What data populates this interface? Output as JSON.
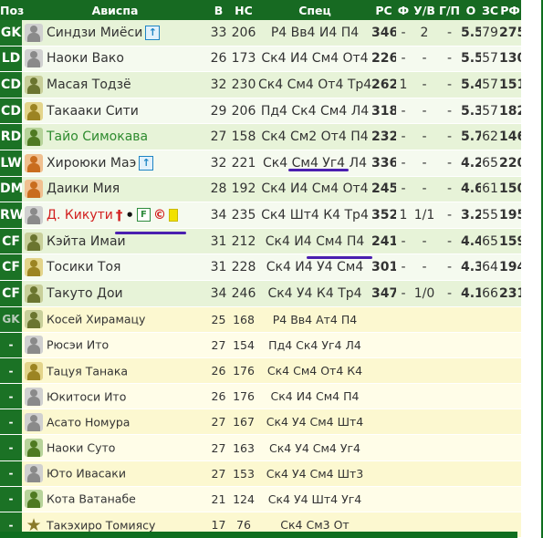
{
  "headers": {
    "pos": "Поз",
    "name": "Ависпа",
    "age": "В",
    "hs": "НС",
    "spec": "Спец",
    "rs": "РС",
    "f": "Ф",
    "uv": "У/В",
    "gp": "Г/П",
    "o": "О",
    "zs": "ЗС",
    "rf": "РФ"
  },
  "colors": {
    "header_green": "#176a22",
    "underline": "#4a1fb0",
    "bold_value_color": "#333333"
  },
  "starters": [
    {
      "pos": "GK",
      "name": "Синдзи Миёси",
      "age": "33",
      "hs": "206",
      "spec": "Р4 Вв4 И4 П4",
      "rs": "346",
      "f": "-",
      "uv": "2",
      "gp": "-",
      "o": "5.5",
      "zs": "79",
      "rf": "275",
      "avatar": "gray",
      "icons": [
        "captain-icon"
      ],
      "name_color": "default"
    },
    {
      "pos": "LD",
      "name": "Наоки Вако",
      "age": "26",
      "hs": "173",
      "spec": "Ск4 И4 См4 От4",
      "rs": "226",
      "f": "-",
      "uv": "-",
      "gp": "-",
      "o": "5.5",
      "zs": "57",
      "rf": "130",
      "avatar": "gray",
      "icons": [],
      "name_color": "default"
    },
    {
      "pos": "CD",
      "name": "Масая Тодзё",
      "age": "32",
      "hs": "230",
      "spec": "Ск4 См4 От4 Тр4",
      "rs": "262",
      "f": "1",
      "uv": "-",
      "gp": "-",
      "o": "5.4",
      "zs": "57",
      "rf": "151",
      "avatar": "olive",
      "icons": [],
      "name_color": "default"
    },
    {
      "pos": "CD",
      "name": "Такааки Сити",
      "age": "29",
      "hs": "206",
      "spec": "Пд4 Ск4 См4 Л4",
      "rs": "318",
      "f": "-",
      "uv": "-",
      "gp": "-",
      "o": "5.3",
      "zs": "57",
      "rf": "182",
      "avatar": "gold",
      "icons": [],
      "name_color": "default"
    },
    {
      "pos": "RD",
      "name": "Тайо Симокава",
      "age": "27",
      "hs": "158",
      "spec": "Ск4 См2 От4 П4",
      "rs": "232",
      "f": "-",
      "uv": "-",
      "gp": "-",
      "o": "5.7",
      "zs": "62",
      "rf": "146",
      "avatar": "green",
      "icons": [],
      "name_color": "green"
    },
    {
      "pos": "LW",
      "name": "Хироюки Маэ",
      "age": "32",
      "hs": "221",
      "spec": "Ск4 См4 Уг4 Л4",
      "rs": "336",
      "f": "-",
      "uv": "-",
      "gp": "-",
      "o": "4.2",
      "zs": "65",
      "rf": "220",
      "avatar": "orange",
      "icons": [
        "captain-icon"
      ],
      "name_color": "default"
    },
    {
      "pos": "DM",
      "name": "Даики Мия",
      "age": "28",
      "hs": "192",
      "spec": "Ск4 И4 См4 От4",
      "rs": "245",
      "f": "-",
      "uv": "-",
      "gp": "-",
      "o": "4.6",
      "zs": "61",
      "rf": "150",
      "avatar": "orange",
      "icons": [],
      "name_color": "default"
    },
    {
      "pos": "RW",
      "name": "Д. Кикути",
      "age": "34",
      "hs": "235",
      "spec": "Ск4 Шт4 К4 Тр4",
      "rs": "352",
      "f": "1",
      "uv": "1/1",
      "gp": "-",
      "o": "3.2",
      "zs": "55",
      "rf": "195",
      "avatar": "gray",
      "icons": [
        "runner-icon",
        "kick-icon",
        "flag-icon",
        "copyright-icon",
        "yellow-card-icon"
      ],
      "name_color": "red"
    },
    {
      "pos": "CF",
      "name": "Кэйта Имаи",
      "age": "31",
      "hs": "212",
      "spec": "Ск4 И4 См4 П4",
      "rs": "241",
      "f": "-",
      "uv": "-",
      "gp": "-",
      "o": "4.4",
      "zs": "65",
      "rf": "159",
      "avatar": "olive",
      "icons": [],
      "name_color": "default"
    },
    {
      "pos": "CF",
      "name": "Тосики Тоя",
      "age": "31",
      "hs": "228",
      "spec": "Ск4 И4 У4 См4",
      "rs": "301",
      "f": "-",
      "uv": "-",
      "gp": "-",
      "o": "4.3",
      "zs": "64",
      "rf": "194",
      "avatar": "gold",
      "icons": [],
      "name_color": "default"
    },
    {
      "pos": "CF",
      "name": "Такуто Дои",
      "age": "34",
      "hs": "246",
      "spec": "Ск4 У4 К4 Тр4",
      "rs": "347",
      "f": "-",
      "uv": "1/0",
      "gp": "-",
      "o": "4.1",
      "zs": "66",
      "rf": "231",
      "avatar": "olive",
      "icons": [],
      "name_color": "default"
    }
  ],
  "subs": [
    {
      "pos": "GK",
      "name": "Косей Хирамацу",
      "age": "25",
      "hs": "168",
      "spec": "Р4 Вв4 Ат4 П4",
      "avatar": "olive"
    },
    {
      "pos": "-",
      "name": "Рюсэи Ито",
      "age": "27",
      "hs": "154",
      "spec": "Пд4 Ск4 Уг4 Л4",
      "avatar": "gray"
    },
    {
      "pos": "-",
      "name": "Тацуя Танака",
      "age": "26",
      "hs": "176",
      "spec": "Ск4 См4 От4 К4",
      "avatar": "gold"
    },
    {
      "pos": "-",
      "name": "Юкитоси Ито",
      "age": "26",
      "hs": "176",
      "spec": "Ск4 И4 См4 П4",
      "avatar": "gray"
    },
    {
      "pos": "-",
      "name": "Асато Номура",
      "age": "27",
      "hs": "167",
      "spec": "Ск4 У4 См4 Шт4",
      "avatar": "gray"
    },
    {
      "pos": "-",
      "name": "Наоки Суто",
      "age": "27",
      "hs": "163",
      "spec": "Ск4 У4 См4 Уг4",
      "avatar": "green"
    },
    {
      "pos": "-",
      "name": "Юто Ивасаки",
      "age": "27",
      "hs": "153",
      "spec": "Ск4 У4 См4 Шт3",
      "avatar": "gray"
    },
    {
      "pos": "-",
      "name": "Кота Ватанабе",
      "age": "21",
      "hs": "124",
      "spec": "Ск4 У4 Шт4 Уг4",
      "avatar": "green"
    },
    {
      "pos": "-",
      "name": "Такэхиро Томиясу",
      "age": "17",
      "hs": "76",
      "spec": "Ск4 См3 От",
      "avatar": "star"
    }
  ]
}
